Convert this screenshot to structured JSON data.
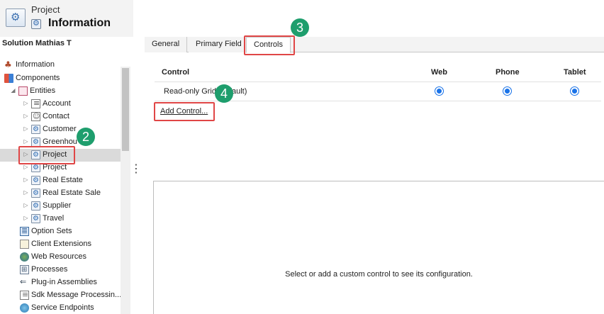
{
  "header": {
    "entity_label": "Project",
    "title": "Information"
  },
  "sidebar": {
    "solution_name": "Solution Mathias T",
    "tree": [
      {
        "label": "Information",
        "icon": "information-icon",
        "level": 0
      },
      {
        "label": "Components",
        "icon": "components-icon",
        "level": 0
      },
      {
        "label": "Entities",
        "icon": "entities-icon",
        "level": 1,
        "expanded": true
      },
      {
        "label": "Account",
        "icon": "account-icon",
        "level": 2
      },
      {
        "label": "Contact",
        "icon": "contact-icon",
        "level": 2
      },
      {
        "label": "Customer",
        "icon": "entity-icon",
        "level": 2
      },
      {
        "label": "Greenhou",
        "icon": "entity-icon",
        "level": 2
      },
      {
        "label": "Project",
        "icon": "entity-icon",
        "level": 2,
        "selected": true
      },
      {
        "label": "Project",
        "icon": "entity-icon",
        "level": 2
      },
      {
        "label": "Real Estate",
        "icon": "entity-icon",
        "level": 2
      },
      {
        "label": "Real Estate Sale",
        "icon": "entity-icon",
        "level": 2
      },
      {
        "label": "Supplier",
        "icon": "entity-icon",
        "level": 2
      },
      {
        "label": "Travel",
        "icon": "entity-icon",
        "level": 2
      },
      {
        "label": "Option Sets",
        "icon": "option-sets-icon",
        "level": 1
      },
      {
        "label": "Client Extensions",
        "icon": "client-extensions-icon",
        "level": 1
      },
      {
        "label": "Web Resources",
        "icon": "web-resources-icon",
        "level": 1
      },
      {
        "label": "Processes",
        "icon": "processes-icon",
        "level": 1
      },
      {
        "label": "Plug-in Assemblies",
        "icon": "plugin-icon",
        "level": 1
      },
      {
        "label": "Sdk Message Processin...",
        "icon": "sdk-message-icon",
        "level": 1
      },
      {
        "label": "Service Endpoints",
        "icon": "service-endpoints-icon",
        "level": 1
      }
    ]
  },
  "tabs": [
    {
      "label": "General"
    },
    {
      "label": "Primary Field"
    },
    {
      "label": "Controls",
      "active": true
    }
  ],
  "controls_grid": {
    "headers": {
      "control": "Control",
      "web": "Web",
      "phone": "Phone",
      "tablet": "Tablet"
    },
    "rows": [
      {
        "control": "Read-only Grid (default)",
        "web": true,
        "phone": true,
        "tablet": true
      }
    ],
    "add_link": "Add Control..."
  },
  "config_message": "Select or add a custom control to see its configuration.",
  "callouts": [
    "2",
    "3",
    "4"
  ],
  "colors": {
    "highlight": "#e04646",
    "callout": "#1e9e6d",
    "radio": "#1a73e8",
    "selection": "#dadada"
  }
}
